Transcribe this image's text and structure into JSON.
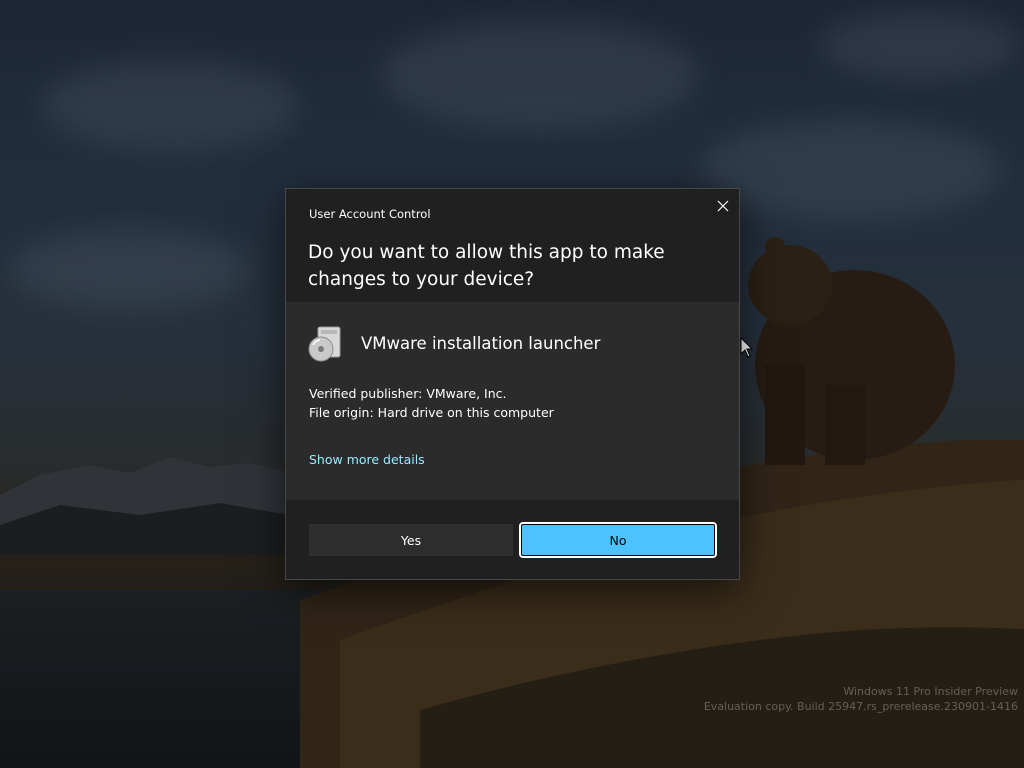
{
  "desktop": {
    "watermark": {
      "line1": "Windows 11 Pro Insider Preview",
      "line2": "Evaluation copy. Build 25947.rs_prerelease.230901-1416"
    }
  },
  "dialog": {
    "title": "User Account Control",
    "question": "Do you want to allow this app to make changes to your device?",
    "close_icon": "close-icon",
    "app": {
      "icon": "installer-disc-icon",
      "name": "VMware installation launcher"
    },
    "publisher": "Verified publisher: VMware, Inc.",
    "origin": "File origin: Hard drive on this computer",
    "more_details_link": "Show more details",
    "buttons": {
      "yes_label": "Yes",
      "no_label": "No"
    },
    "colors": {
      "accent": "#4cc2ff",
      "link": "#99ebff",
      "background": "#2b2b2b",
      "header_footer": "#202020"
    }
  }
}
